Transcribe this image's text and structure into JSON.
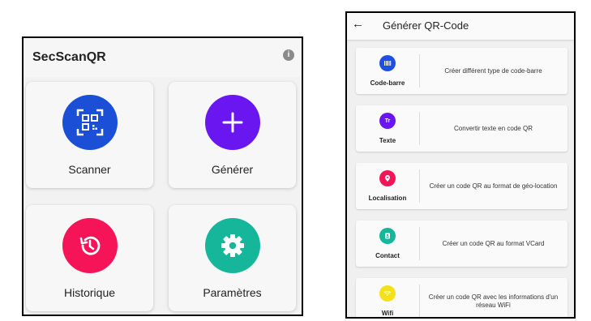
{
  "home": {
    "title": "SecScanQR",
    "info_icon": "info-icon",
    "tiles": [
      {
        "label": "Scanner",
        "icon": "qr-scan-icon",
        "color": "#1a4fd6"
      },
      {
        "label": "Générer",
        "icon": "plus-icon",
        "color": "#6a16f0"
      },
      {
        "label": "Historique",
        "icon": "history-icon",
        "color": "#f51457"
      },
      {
        "label": "Paramètres",
        "icon": "gear-icon",
        "color": "#16b69a"
      }
    ]
  },
  "generate": {
    "back_icon": "←",
    "title": "Générer QR-Code",
    "items": [
      {
        "name": "Code-barre",
        "desc": "Créer différent type de code-barre",
        "icon": "barcode-icon",
        "color": "#1d4fe0"
      },
      {
        "name": "Texte",
        "desc": "Convertir texte en code QR",
        "icon_text": "Tr",
        "icon": "text-icon",
        "color": "#6a16f0"
      },
      {
        "name": "Localisation",
        "desc": "Créer un code QR au format de géo-location",
        "icon": "location-icon",
        "color": "#f51457"
      },
      {
        "name": "Contact",
        "desc": "Créer un code QR au format VCard",
        "icon": "contact-icon",
        "color": "#16b69a"
      },
      {
        "name": "Wifi",
        "desc": "Créer un code QR avec les informations d'un réseau WiFi",
        "icon": "wifi-icon",
        "color": "#f5e11a"
      }
    ]
  }
}
